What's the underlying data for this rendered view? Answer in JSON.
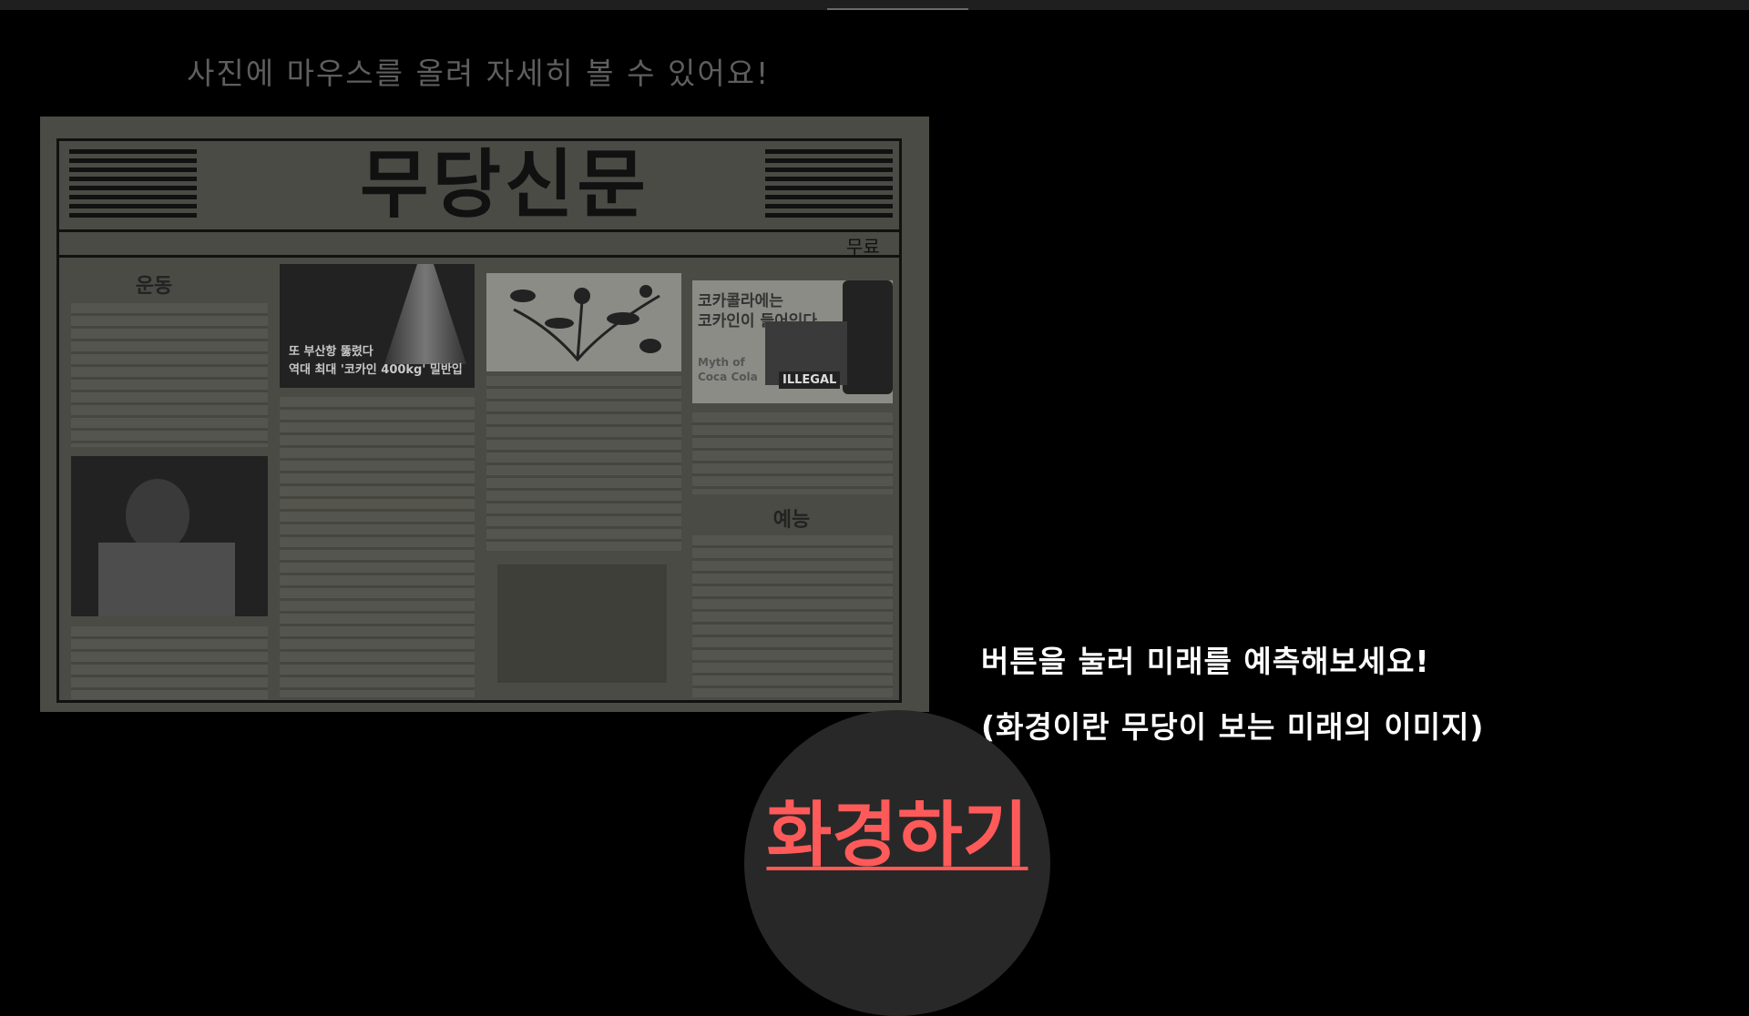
{
  "hint_text": "사진에 마우스를 올려 자세히 볼 수 있어요!",
  "newspaper": {
    "title": "무당신문",
    "price": "무료",
    "sections": {
      "sports": "운동",
      "entertainment": "예능"
    },
    "articles": {
      "photo1_line1": "또 부산항 뚫렸다",
      "photo1_line2": "역대 최대 '코카인 400kg' 밀반입",
      "photo3_line1": "코카콜라에는",
      "photo3_line2": "코카인이 들어있다",
      "photo3_sub1": "Myth of",
      "photo3_sub2": "Coca Cola",
      "photo3_badge": "ILLEGAL"
    }
  },
  "prompt": {
    "line1": "버튼을 눌러 미래를 예측해보세요!",
    "line2": "(화경이란 무당이 보는 미래의 이미지)"
  },
  "button": {
    "label": "화경하기",
    "accent_color": "#ff5a5a"
  }
}
